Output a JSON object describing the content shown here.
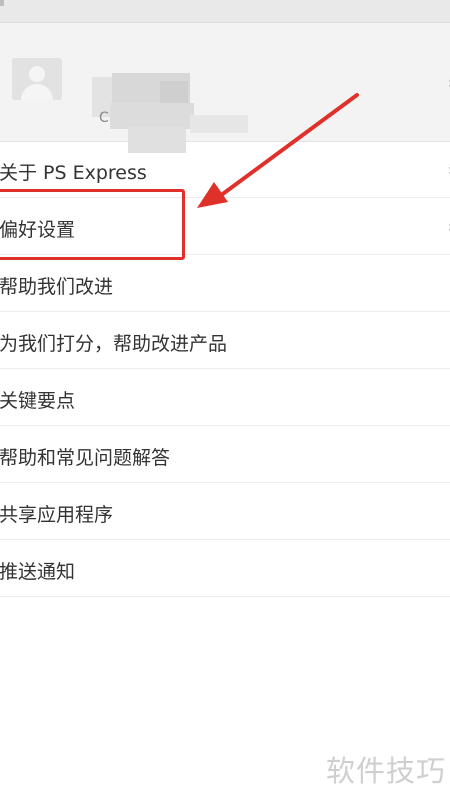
{
  "profile": {
    "subtitle": "C"
  },
  "menu": {
    "items": [
      {
        "label": "关于 PS Express"
      },
      {
        "label": "偏好设置"
      },
      {
        "label": "帮助我们改进"
      },
      {
        "label": "为我们打分，帮助改进产品"
      },
      {
        "label": "关键要点"
      },
      {
        "label": "帮助和常见问题解答"
      },
      {
        "label": "共享应用程序"
      },
      {
        "label": "推送通知"
      }
    ]
  },
  "watermark": {
    "text": "软件技巧"
  },
  "annotation": {
    "color": "#e0302a"
  },
  "icons": {
    "avatar": "user-avatar-icon",
    "chevron": "chevron-right-icon"
  }
}
